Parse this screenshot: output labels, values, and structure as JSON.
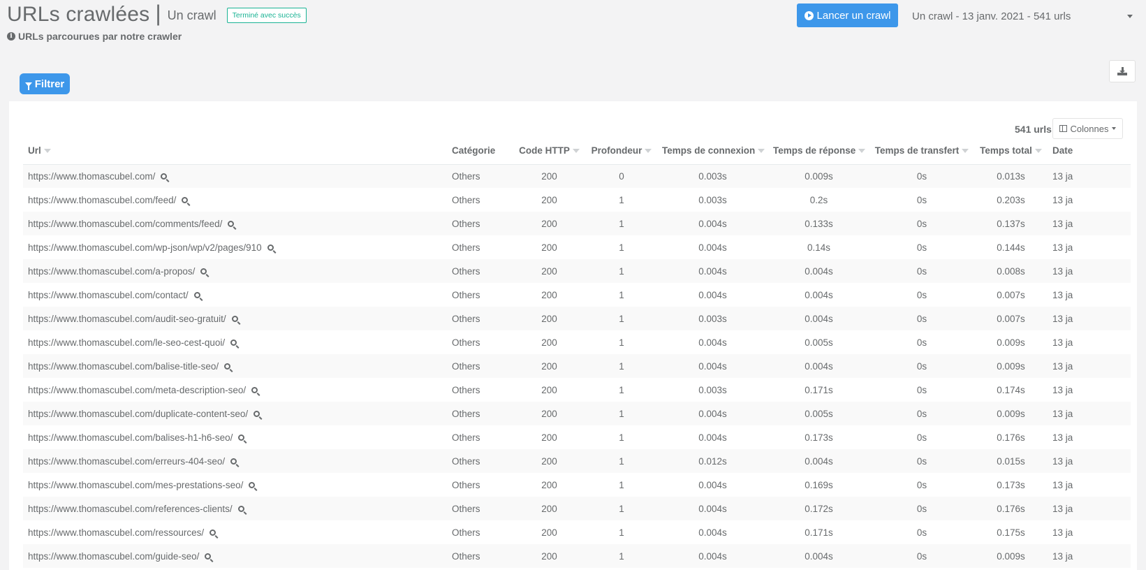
{
  "header": {
    "title": "URLs crawlées",
    "separator": "|",
    "crawl_name": "Un crawl",
    "status": "Terminé avec succès",
    "subtitle": "URLs parcourues par notre crawler",
    "launch_button": "Lancer un crawl",
    "crawl_selector": "Un crawl - 13 janv. 2021 - 541 urls"
  },
  "toolbar": {
    "filter_button": "Filtrer",
    "url_count": "541 urls",
    "columns_button": "Colonnes"
  },
  "colors": {
    "primary": "#3d97ea",
    "success": "#1ab394",
    "text": "#676a6c"
  },
  "table": {
    "columns": [
      "Url",
      "Catégorie",
      "Code HTTP",
      "Profondeur",
      "Temps de connexion",
      "Temps de réponse",
      "Temps de transfert",
      "Temps total",
      "Date"
    ],
    "rows": [
      {
        "url": "https://www.thomascubel.com/",
        "category": "Others",
        "code": "200",
        "depth": "0",
        "connect": "0.003s",
        "response": "0.009s",
        "transfer": "0s",
        "total": "0.013s",
        "date": "13 ja"
      },
      {
        "url": "https://www.thomascubel.com/feed/",
        "category": "Others",
        "code": "200",
        "depth": "1",
        "connect": "0.003s",
        "response": "0.2s",
        "transfer": "0s",
        "total": "0.203s",
        "date": "13 ja"
      },
      {
        "url": "https://www.thomascubel.com/comments/feed/",
        "category": "Others",
        "code": "200",
        "depth": "1",
        "connect": "0.004s",
        "response": "0.133s",
        "transfer": "0s",
        "total": "0.137s",
        "date": "13 ja"
      },
      {
        "url": "https://www.thomascubel.com/wp-json/wp/v2/pages/910",
        "category": "Others",
        "code": "200",
        "depth": "1",
        "connect": "0.004s",
        "response": "0.14s",
        "transfer": "0s",
        "total": "0.144s",
        "date": "13 ja"
      },
      {
        "url": "https://www.thomascubel.com/a-propos/",
        "category": "Others",
        "code": "200",
        "depth": "1",
        "connect": "0.004s",
        "response": "0.004s",
        "transfer": "0s",
        "total": "0.008s",
        "date": "13 ja"
      },
      {
        "url": "https://www.thomascubel.com/contact/",
        "category": "Others",
        "code": "200",
        "depth": "1",
        "connect": "0.004s",
        "response": "0.004s",
        "transfer": "0s",
        "total": "0.007s",
        "date": "13 ja"
      },
      {
        "url": "https://www.thomascubel.com/audit-seo-gratuit/",
        "category": "Others",
        "code": "200",
        "depth": "1",
        "connect": "0.003s",
        "response": "0.004s",
        "transfer": "0s",
        "total": "0.007s",
        "date": "13 ja"
      },
      {
        "url": "https://www.thomascubel.com/le-seo-cest-quoi/",
        "category": "Others",
        "code": "200",
        "depth": "1",
        "connect": "0.004s",
        "response": "0.005s",
        "transfer": "0s",
        "total": "0.009s",
        "date": "13 ja"
      },
      {
        "url": "https://www.thomascubel.com/balise-title-seo/",
        "category": "Others",
        "code": "200",
        "depth": "1",
        "connect": "0.004s",
        "response": "0.004s",
        "transfer": "0s",
        "total": "0.009s",
        "date": "13 ja"
      },
      {
        "url": "https://www.thomascubel.com/meta-description-seo/",
        "category": "Others",
        "code": "200",
        "depth": "1",
        "connect": "0.003s",
        "response": "0.171s",
        "transfer": "0s",
        "total": "0.174s",
        "date": "13 ja"
      },
      {
        "url": "https://www.thomascubel.com/duplicate-content-seo/",
        "category": "Others",
        "code": "200",
        "depth": "1",
        "connect": "0.004s",
        "response": "0.005s",
        "transfer": "0s",
        "total": "0.009s",
        "date": "13 ja"
      },
      {
        "url": "https://www.thomascubel.com/balises-h1-h6-seo/",
        "category": "Others",
        "code": "200",
        "depth": "1",
        "connect": "0.004s",
        "response": "0.173s",
        "transfer": "0s",
        "total": "0.176s",
        "date": "13 ja"
      },
      {
        "url": "https://www.thomascubel.com/erreurs-404-seo/",
        "category": "Others",
        "code": "200",
        "depth": "1",
        "connect": "0.012s",
        "response": "0.004s",
        "transfer": "0s",
        "total": "0.015s",
        "date": "13 ja"
      },
      {
        "url": "https://www.thomascubel.com/mes-prestations-seo/",
        "category": "Others",
        "code": "200",
        "depth": "1",
        "connect": "0.004s",
        "response": "0.169s",
        "transfer": "0s",
        "total": "0.173s",
        "date": "13 ja"
      },
      {
        "url": "https://www.thomascubel.com/references-clients/",
        "category": "Others",
        "code": "200",
        "depth": "1",
        "connect": "0.004s",
        "response": "0.172s",
        "transfer": "0s",
        "total": "0.176s",
        "date": "13 ja"
      },
      {
        "url": "https://www.thomascubel.com/ressources/",
        "category": "Others",
        "code": "200",
        "depth": "1",
        "connect": "0.004s",
        "response": "0.171s",
        "transfer": "0s",
        "total": "0.175s",
        "date": "13 ja"
      },
      {
        "url": "https://www.thomascubel.com/guide-seo/",
        "category": "Others",
        "code": "200",
        "depth": "1",
        "connect": "0.004s",
        "response": "0.004s",
        "transfer": "0s",
        "total": "0.009s",
        "date": "13 ja"
      }
    ]
  }
}
